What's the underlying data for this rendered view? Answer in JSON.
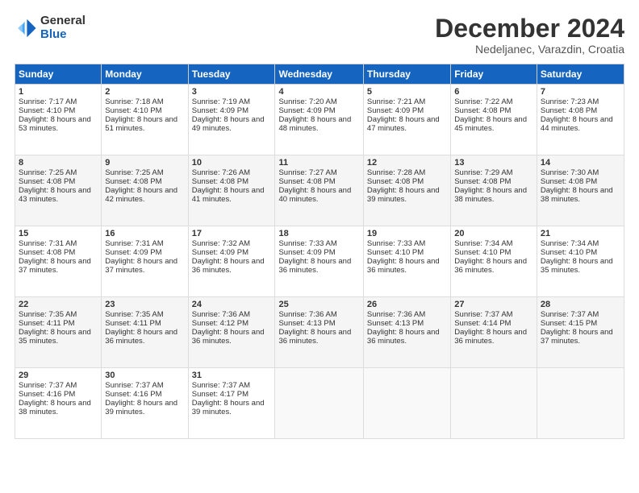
{
  "logo": {
    "general": "General",
    "blue": "Blue"
  },
  "title": "December 2024",
  "location": "Nedeljanec, Varazdin, Croatia",
  "headers": [
    "Sunday",
    "Monday",
    "Tuesday",
    "Wednesday",
    "Thursday",
    "Friday",
    "Saturday"
  ],
  "weeks": [
    [
      {
        "day": "1",
        "sunrise": "7:17 AM",
        "sunset": "4:10 PM",
        "daylight": "8 hours and 53 minutes."
      },
      {
        "day": "2",
        "sunrise": "7:18 AM",
        "sunset": "4:10 PM",
        "daylight": "8 hours and 51 minutes."
      },
      {
        "day": "3",
        "sunrise": "7:19 AM",
        "sunset": "4:09 PM",
        "daylight": "8 hours and 49 minutes."
      },
      {
        "day": "4",
        "sunrise": "7:20 AM",
        "sunset": "4:09 PM",
        "daylight": "8 hours and 48 minutes."
      },
      {
        "day": "5",
        "sunrise": "7:21 AM",
        "sunset": "4:09 PM",
        "daylight": "8 hours and 47 minutes."
      },
      {
        "day": "6",
        "sunrise": "7:22 AM",
        "sunset": "4:08 PM",
        "daylight": "8 hours and 45 minutes."
      },
      {
        "day": "7",
        "sunrise": "7:23 AM",
        "sunset": "4:08 PM",
        "daylight": "8 hours and 44 minutes."
      }
    ],
    [
      {
        "day": "8",
        "sunrise": "7:25 AM",
        "sunset": "4:08 PM",
        "daylight": "8 hours and 43 minutes."
      },
      {
        "day": "9",
        "sunrise": "7:25 AM",
        "sunset": "4:08 PM",
        "daylight": "8 hours and 42 minutes."
      },
      {
        "day": "10",
        "sunrise": "7:26 AM",
        "sunset": "4:08 PM",
        "daylight": "8 hours and 41 minutes."
      },
      {
        "day": "11",
        "sunrise": "7:27 AM",
        "sunset": "4:08 PM",
        "daylight": "8 hours and 40 minutes."
      },
      {
        "day": "12",
        "sunrise": "7:28 AM",
        "sunset": "4:08 PM",
        "daylight": "8 hours and 39 minutes."
      },
      {
        "day": "13",
        "sunrise": "7:29 AM",
        "sunset": "4:08 PM",
        "daylight": "8 hours and 38 minutes."
      },
      {
        "day": "14",
        "sunrise": "7:30 AM",
        "sunset": "4:08 PM",
        "daylight": "8 hours and 38 minutes."
      }
    ],
    [
      {
        "day": "15",
        "sunrise": "7:31 AM",
        "sunset": "4:08 PM",
        "daylight": "8 hours and 37 minutes."
      },
      {
        "day": "16",
        "sunrise": "7:31 AM",
        "sunset": "4:09 PM",
        "daylight": "8 hours and 37 minutes."
      },
      {
        "day": "17",
        "sunrise": "7:32 AM",
        "sunset": "4:09 PM",
        "daylight": "8 hours and 36 minutes."
      },
      {
        "day": "18",
        "sunrise": "7:33 AM",
        "sunset": "4:09 PM",
        "daylight": "8 hours and 36 minutes."
      },
      {
        "day": "19",
        "sunrise": "7:33 AM",
        "sunset": "4:10 PM",
        "daylight": "8 hours and 36 minutes."
      },
      {
        "day": "20",
        "sunrise": "7:34 AM",
        "sunset": "4:10 PM",
        "daylight": "8 hours and 36 minutes."
      },
      {
        "day": "21",
        "sunrise": "7:34 AM",
        "sunset": "4:10 PM",
        "daylight": "8 hours and 35 minutes."
      }
    ],
    [
      {
        "day": "22",
        "sunrise": "7:35 AM",
        "sunset": "4:11 PM",
        "daylight": "8 hours and 35 minutes."
      },
      {
        "day": "23",
        "sunrise": "7:35 AM",
        "sunset": "4:11 PM",
        "daylight": "8 hours and 36 minutes."
      },
      {
        "day": "24",
        "sunrise": "7:36 AM",
        "sunset": "4:12 PM",
        "daylight": "8 hours and 36 minutes."
      },
      {
        "day": "25",
        "sunrise": "7:36 AM",
        "sunset": "4:13 PM",
        "daylight": "8 hours and 36 minutes."
      },
      {
        "day": "26",
        "sunrise": "7:36 AM",
        "sunset": "4:13 PM",
        "daylight": "8 hours and 36 minutes."
      },
      {
        "day": "27",
        "sunrise": "7:37 AM",
        "sunset": "4:14 PM",
        "daylight": "8 hours and 36 minutes."
      },
      {
        "day": "28",
        "sunrise": "7:37 AM",
        "sunset": "4:15 PM",
        "daylight": "8 hours and 37 minutes."
      }
    ],
    [
      {
        "day": "29",
        "sunrise": "7:37 AM",
        "sunset": "4:16 PM",
        "daylight": "8 hours and 38 minutes."
      },
      {
        "day": "30",
        "sunrise": "7:37 AM",
        "sunset": "4:16 PM",
        "daylight": "8 hours and 39 minutes."
      },
      {
        "day": "31",
        "sunrise": "7:37 AM",
        "sunset": "4:17 PM",
        "daylight": "8 hours and 39 minutes."
      },
      null,
      null,
      null,
      null
    ]
  ]
}
